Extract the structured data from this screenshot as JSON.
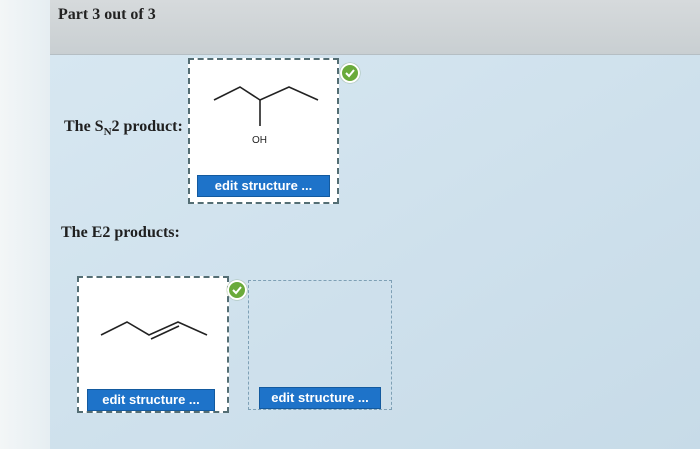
{
  "header": {
    "part_label": "Part 3 out of 3"
  },
  "sn2": {
    "prompt_prefix": "The S",
    "prompt_subscript": "N",
    "prompt_suffix": "2 product:",
    "oh_label": "OH",
    "edit_button": "edit structure ..."
  },
  "e2": {
    "prompt": "The E2 products:",
    "product1_edit_button": "edit structure ...",
    "product2_edit_button": "edit structure ..."
  },
  "icons": {
    "check": "check-circle-icon"
  },
  "colors": {
    "button": "#1e73c9",
    "check": "#6aaa3a"
  }
}
